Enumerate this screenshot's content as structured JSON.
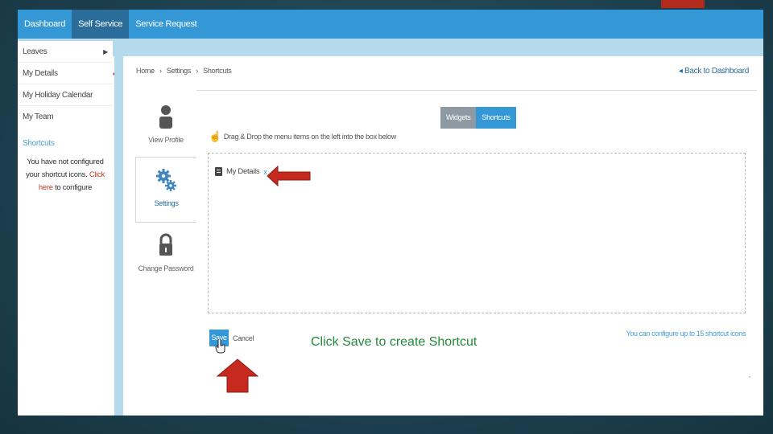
{
  "topbar": {
    "items": [
      "Dashboard",
      "Self Service",
      "Service Request"
    ],
    "active": "Self Service"
  },
  "sidebar": {
    "items": [
      "Leaves",
      "My Details",
      "My Holiday Calendar",
      "My Team"
    ],
    "section_title": "Shortcuts",
    "note_prefix": "You have not configured your shortcut icons.",
    "note_link": "Click here",
    "note_suffix": "to configure"
  },
  "breadcrumb": [
    "Home",
    "›",
    "Settings",
    "›",
    "Shortcuts"
  ],
  "back_link": "Back to Dashboard",
  "settings_nav": {
    "view_profile": "View Profile",
    "settings": "Settings",
    "change_password": "Change Password"
  },
  "tabs": {
    "widgets": "Widgets",
    "shortcuts": "Shortcuts"
  },
  "instruction": "Drag & Drop the menu items on the left into the box below",
  "shortcut_chip": {
    "label": "My Details",
    "remove": "x"
  },
  "actions": {
    "save": "Save",
    "cancel": "Cancel"
  },
  "hint": "You can configure up to 15 shortcut icons",
  "annotation": "Click Save to create Shortcut",
  "colors": {
    "accent": "#3497d6",
    "annotation_arrow": "#c62a1f",
    "annotation_text": "#22893a"
  }
}
